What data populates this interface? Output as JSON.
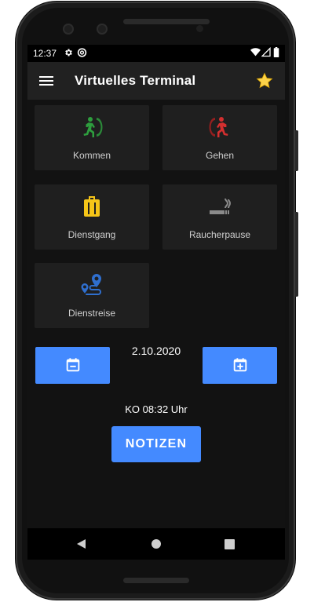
{
  "status_bar": {
    "time": "12:37"
  },
  "app_bar": {
    "title": "Virtuelles Terminal"
  },
  "actions": [
    {
      "label": "Kommen",
      "icon": "entering-person-icon",
      "color": "#2e9e3e"
    },
    {
      "label": "Gehen",
      "icon": "exiting-person-icon",
      "color": "#d32f2f"
    },
    {
      "label": "Dienstgang",
      "icon": "suitcase-icon",
      "color": "#f5c518"
    },
    {
      "label": "Raucherpause",
      "icon": "smoking-icon",
      "color": "#8a8a8a"
    },
    {
      "label": "Dienstreise",
      "icon": "route-icon",
      "color": "#2f6fcf"
    }
  ],
  "date": {
    "value": "2.10.2020"
  },
  "last_booking": "KO 08:32 Uhr",
  "notes_button": "NOTIZEN",
  "colors": {
    "accent": "#448aff",
    "tile": "#1f1f1f",
    "background": "#121212"
  }
}
